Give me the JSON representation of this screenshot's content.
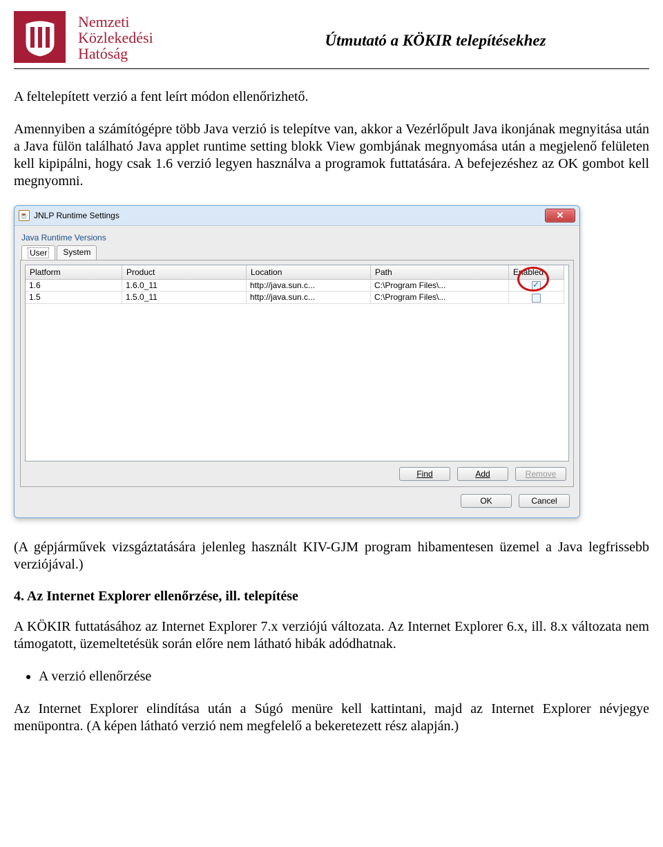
{
  "header": {
    "org_line1": "Nemzeti",
    "org_line2": "Közlekedési",
    "org_line3": "Hatóság",
    "doc_title": "Útmutató a KÖKIR telepítésekhez"
  },
  "paragraphs": {
    "p1": "A feltelepített verzió a fent leírt módon ellenőrizhető.",
    "p2": "Amennyiben a számítógépre több Java verzió is telepítve van, akkor a Vezérlőpult Java ikonjának megnyitása után a Java fülön található Java applet runtime setting blokk View gombjának megnyomása után a megjelenő felületen kell kipipálni, hogy csak 1.6 verzió legyen használva a programok futtatására. A befejezéshez az OK gombot kell megnyomni.",
    "p3": "(A gépjárművek vizsgáztatására jelenleg használt KIV-GJM program hibamentesen üzemel a Java legfrissebb verziójával.)",
    "p4": "A KÖKIR futtatásához az Internet Explorer 7.x verziójú változata. Az Internet Explorer 6.x, ill. 8.x változata nem támogatott, üzemeltetésük során előre nem látható hibák adódhatnak.",
    "p5": "Az Internet Explorer elindítása után a Súgó menüre kell kattintani, majd az Internet Explorer névjegye menüpontra. (A képen látható verzió nem megfelelő a bekeretezett rész alapján.)"
  },
  "section_heading": "4. Az Internet Explorer ellenőrzése, ill. telepítése",
  "bullet1": "A verzió ellenőrzése",
  "dialog": {
    "title": "JNLP Runtime Settings",
    "close_glyph": "✕",
    "group": "Java Runtime Versions",
    "tabs": {
      "user": "User",
      "system": "System"
    },
    "columns": {
      "platform": "Platform",
      "product": "Product",
      "location": "Location",
      "path": "Path",
      "enabled": "Enabled"
    },
    "rows": [
      {
        "platform": "1.6",
        "product": "1.6.0_11",
        "location": "http://java.sun.c...",
        "path": "C:\\Program Files\\...",
        "enabled": true
      },
      {
        "platform": "1.5",
        "product": "1.5.0_11",
        "location": "http://java.sun.c...",
        "path": "C:\\Program Files\\...",
        "enabled": false
      }
    ],
    "buttons": {
      "find": "Find",
      "add": "Add",
      "remove": "Remove",
      "ok": "OK",
      "cancel": "Cancel"
    }
  }
}
